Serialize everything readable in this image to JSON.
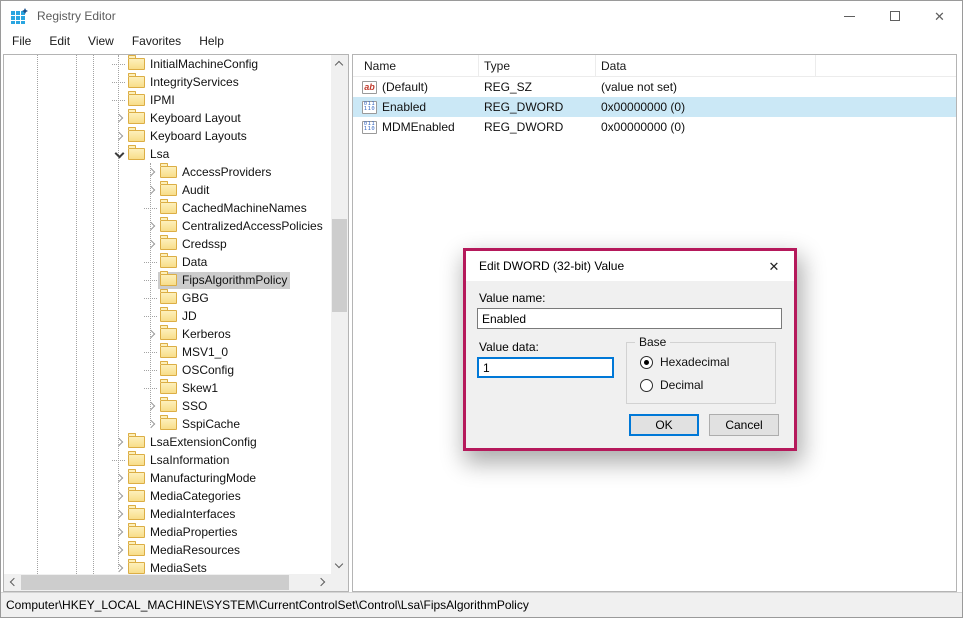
{
  "colors": {
    "accent_blue": "#0078d7",
    "selection_blue": "#cbe8f6",
    "inactive_selection_gray": "#cccccc",
    "dialog_outline": "#b5195b",
    "folder_yellow": "#f8dd8a"
  },
  "window": {
    "title": "Registry Editor"
  },
  "menu": {
    "items": [
      "File",
      "Edit",
      "View",
      "Favorites",
      "Help"
    ]
  },
  "tree": {
    "items": [
      {
        "label": "InitialMachineConfig",
        "level": 0,
        "state": "leaf"
      },
      {
        "label": "IntegrityServices",
        "level": 0,
        "state": "leaf"
      },
      {
        "label": "IPMI",
        "level": 0,
        "state": "leaf"
      },
      {
        "label": "Keyboard Layout",
        "level": 0,
        "state": "collapsed"
      },
      {
        "label": "Keyboard Layouts",
        "level": 0,
        "state": "collapsed"
      },
      {
        "label": "Lsa",
        "level": 0,
        "state": "expanded"
      },
      {
        "label": "AccessProviders",
        "level": 1,
        "state": "collapsed"
      },
      {
        "label": "Audit",
        "level": 1,
        "state": "collapsed"
      },
      {
        "label": "CachedMachineNames",
        "level": 1,
        "state": "leaf"
      },
      {
        "label": "CentralizedAccessPolicies",
        "level": 1,
        "state": "collapsed"
      },
      {
        "label": "Credssp",
        "level": 1,
        "state": "collapsed"
      },
      {
        "label": "Data",
        "level": 1,
        "state": "leaf"
      },
      {
        "label": "FipsAlgorithmPolicy",
        "level": 1,
        "state": "leaf",
        "selected": true
      },
      {
        "label": "GBG",
        "level": 1,
        "state": "leaf"
      },
      {
        "label": "JD",
        "level": 1,
        "state": "leaf"
      },
      {
        "label": "Kerberos",
        "level": 1,
        "state": "collapsed"
      },
      {
        "label": "MSV1_0",
        "level": 1,
        "state": "leaf"
      },
      {
        "label": "OSConfig",
        "level": 1,
        "state": "leaf"
      },
      {
        "label": "Skew1",
        "level": 1,
        "state": "leaf"
      },
      {
        "label": "SSO",
        "level": 1,
        "state": "collapsed"
      },
      {
        "label": "SspiCache",
        "level": 1,
        "state": "collapsed"
      },
      {
        "label": "LsaExtensionConfig",
        "level": 0,
        "state": "collapsed"
      },
      {
        "label": "LsaInformation",
        "level": 0,
        "state": "leaf"
      },
      {
        "label": "ManufacturingMode",
        "level": 0,
        "state": "collapsed"
      },
      {
        "label": "MediaCategories",
        "level": 0,
        "state": "collapsed"
      },
      {
        "label": "MediaInterfaces",
        "level": 0,
        "state": "collapsed"
      },
      {
        "label": "MediaProperties",
        "level": 0,
        "state": "collapsed"
      },
      {
        "label": "MediaResources",
        "level": 0,
        "state": "collapsed"
      },
      {
        "label": "MediaSets",
        "level": 0,
        "state": "collapsed"
      }
    ]
  },
  "list": {
    "columns": [
      "Name",
      "Type",
      "Data"
    ],
    "icons": {
      "string_icon_text": "ab",
      "dword_icon_lines": [
        "011",
        "110"
      ]
    },
    "rows": [
      {
        "name": "(Default)",
        "type": "REG_SZ",
        "data": "(value not set)",
        "icon": "string"
      },
      {
        "name": "Enabled",
        "type": "REG_DWORD",
        "data": "0x00000000 (0)",
        "icon": "dword",
        "selected": true
      },
      {
        "name": "MDMEnabled",
        "type": "REG_DWORD",
        "data": "0x00000000 (0)",
        "icon": "dword"
      }
    ]
  },
  "dialog": {
    "title": "Edit DWORD (32-bit) Value",
    "close_glyph": "✕",
    "value_name_label": "Value name:",
    "value_name": "Enabled",
    "value_data_label": "Value data:",
    "value_data": "1",
    "base_group_label": "Base",
    "radio_hex": "Hexadecimal",
    "radio_dec": "Decimal",
    "ok_label": "OK",
    "cancel_label": "Cancel"
  },
  "statusbar": {
    "path": "Computer\\HKEY_LOCAL_MACHINE\\SYSTEM\\CurrentControlSet\\Control\\Lsa\\FipsAlgorithmPolicy"
  }
}
